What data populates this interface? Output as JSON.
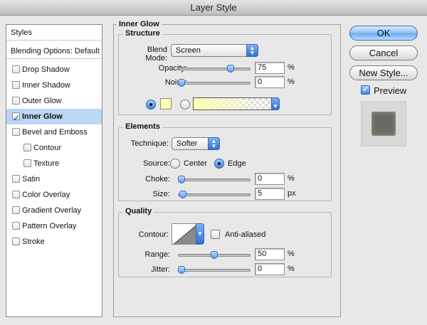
{
  "window": {
    "title": "Layer Style"
  },
  "styles_list": {
    "header": "Styles",
    "blending": "Blending Options: Default",
    "items": [
      {
        "label": "Drop Shadow",
        "checked": false,
        "selected": false,
        "sub": false
      },
      {
        "label": "Inner Shadow",
        "checked": false,
        "selected": false,
        "sub": false
      },
      {
        "label": "Outer Glow",
        "checked": false,
        "selected": false,
        "sub": false
      },
      {
        "label": "Inner Glow",
        "checked": true,
        "selected": true,
        "sub": false
      },
      {
        "label": "Bevel and Emboss",
        "checked": false,
        "selected": false,
        "sub": false
      },
      {
        "label": "Contour",
        "checked": false,
        "selected": false,
        "sub": true
      },
      {
        "label": "Texture",
        "checked": false,
        "selected": false,
        "sub": true
      },
      {
        "label": "Satin",
        "checked": false,
        "selected": false,
        "sub": false
      },
      {
        "label": "Color Overlay",
        "checked": false,
        "selected": false,
        "sub": false
      },
      {
        "label": "Gradient Overlay",
        "checked": false,
        "selected": false,
        "sub": false
      },
      {
        "label": "Pattern Overlay",
        "checked": false,
        "selected": false,
        "sub": false
      },
      {
        "label": "Stroke",
        "checked": false,
        "selected": false,
        "sub": false
      }
    ]
  },
  "panel": {
    "title": "Inner Glow",
    "structure": {
      "legend": "Structure",
      "blend_mode_label": "Blend Mode:",
      "blend_mode_value": "Screen",
      "opacity_label": "Opacity:",
      "opacity_value": "75",
      "opacity_unit": "%",
      "opacity_slider_level": 0.75,
      "noise_label": "Noise:",
      "noise_value": "0",
      "noise_unit": "%",
      "noise_slider_level": 0.0,
      "glow_color": "#ffffb4",
      "gradient_start_color": "#ffffb4",
      "color_radio_selected": true
    },
    "elements": {
      "legend": "Elements",
      "technique_label": "Technique:",
      "technique_value": "Softer",
      "source_label": "Source:",
      "source_center": "Center",
      "source_edge": "Edge",
      "source_selected": "Edge",
      "choke_label": "Choke:",
      "choke_value": "0",
      "choke_unit": "%",
      "choke_slider_level": 0.0,
      "size_label": "Size:",
      "size_value": "5",
      "size_unit": "px",
      "size_slider_level": 0.02
    },
    "quality": {
      "legend": "Quality",
      "contour_label": "Contour:",
      "anti_aliased_label": "Anti-aliased",
      "anti_aliased_checked": false,
      "range_label": "Range:",
      "range_value": "50",
      "range_unit": "%",
      "range_slider_level": 0.5,
      "jitter_label": "Jitter:",
      "jitter_value": "0",
      "jitter_unit": "%",
      "jitter_slider_level": 0.0
    }
  },
  "buttons": {
    "ok": "OK",
    "cancel": "Cancel",
    "new_style": "New Style...",
    "preview_label": "Preview",
    "preview_checked": true
  },
  "colors": {
    "accent": "#5d9cf2",
    "selection": "#bcd6f3",
    "preview_fill": "#696969"
  }
}
